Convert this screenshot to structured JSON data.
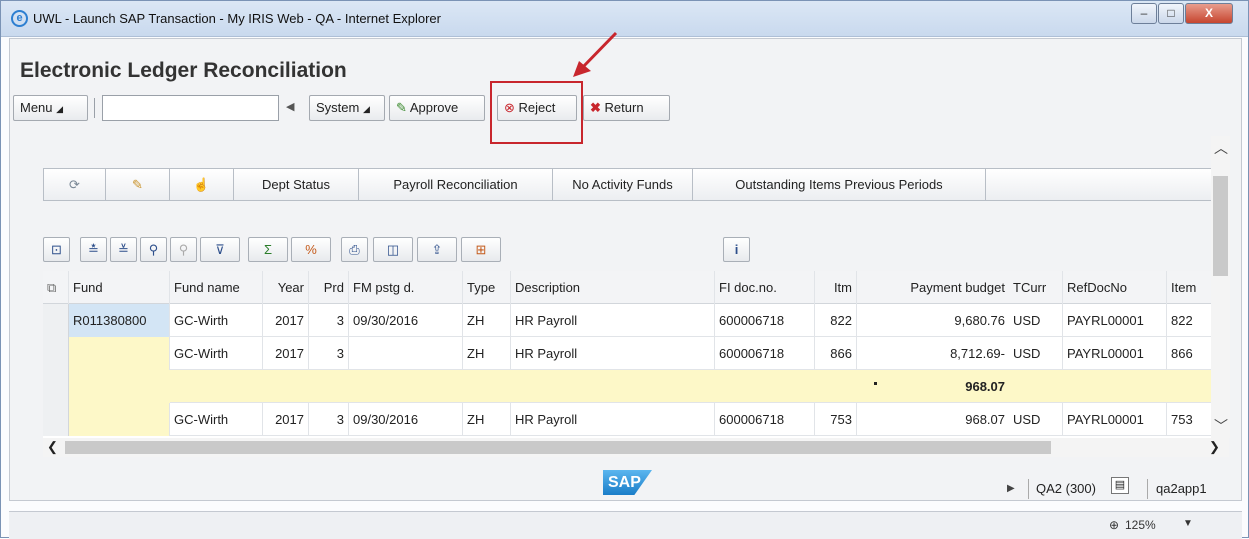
{
  "window": {
    "title": "UWL - Launch SAP Transaction - My IRIS Web - QA - Internet Explorer",
    "minimize": "–",
    "maximize": "□",
    "close": "X"
  },
  "page_title": "Electronic Ledger Reconciliation",
  "toolbar": {
    "menu": "Menu",
    "system": "System",
    "approve": "Approve",
    "reject": "Reject",
    "return": "Return",
    "command_field": ""
  },
  "tabs": [
    "Dept Status",
    "Payroll Reconciliation",
    "No Activity Funds",
    "Outstanding Items Previous Periods"
  ],
  "columns": [
    "Fund",
    "Fund name",
    "Year",
    "Prd",
    "FM pstg d.",
    "Type",
    "Description",
    "FI doc.no.",
    "Itm",
    "Payment budget",
    "TCurr",
    "RefDocNo",
    "Item"
  ],
  "rows": [
    {
      "fund": "R011380800",
      "fund_name": "GC-Wirth",
      "year": "2017",
      "prd": "3",
      "fm_pstg": "09/30/2016",
      "type": "ZH",
      "description": "HR Payroll",
      "fi_doc": "600006718",
      "itm": "822",
      "payment": "9,680.76",
      "tcurr": "USD",
      "refdoc": "PAYRL00001",
      "item": "822"
    },
    {
      "fund": "",
      "fund_name": "GC-Wirth",
      "year": "2017",
      "prd": "3",
      "fm_pstg": "",
      "type": "ZH",
      "description": "HR Payroll",
      "fi_doc": "600006718",
      "itm": "866",
      "payment": "8,712.69-",
      "tcurr": "USD",
      "refdoc": "PAYRL00001",
      "item": "866"
    },
    {
      "subtotal": "968.07"
    },
    {
      "fund": "",
      "fund_name": "GC-Wirth",
      "year": "2017",
      "prd": "3",
      "fm_pstg": "09/30/2016",
      "type": "ZH",
      "description": "HR Payroll",
      "fi_doc": "600006718",
      "itm": "753",
      "payment": "968.07",
      "tcurr": "USD",
      "refdoc": "PAYRL00001",
      "item": "753"
    }
  ],
  "footer": {
    "system": "QA2 (300)",
    "server": "qa2app1",
    "zoom": "125%",
    "logo": "SAP"
  },
  "colors": {
    "reject_highlight": "#c8262d",
    "subtotal_row": "#fdf8c8",
    "selected_cell": "#d3e5f5"
  }
}
